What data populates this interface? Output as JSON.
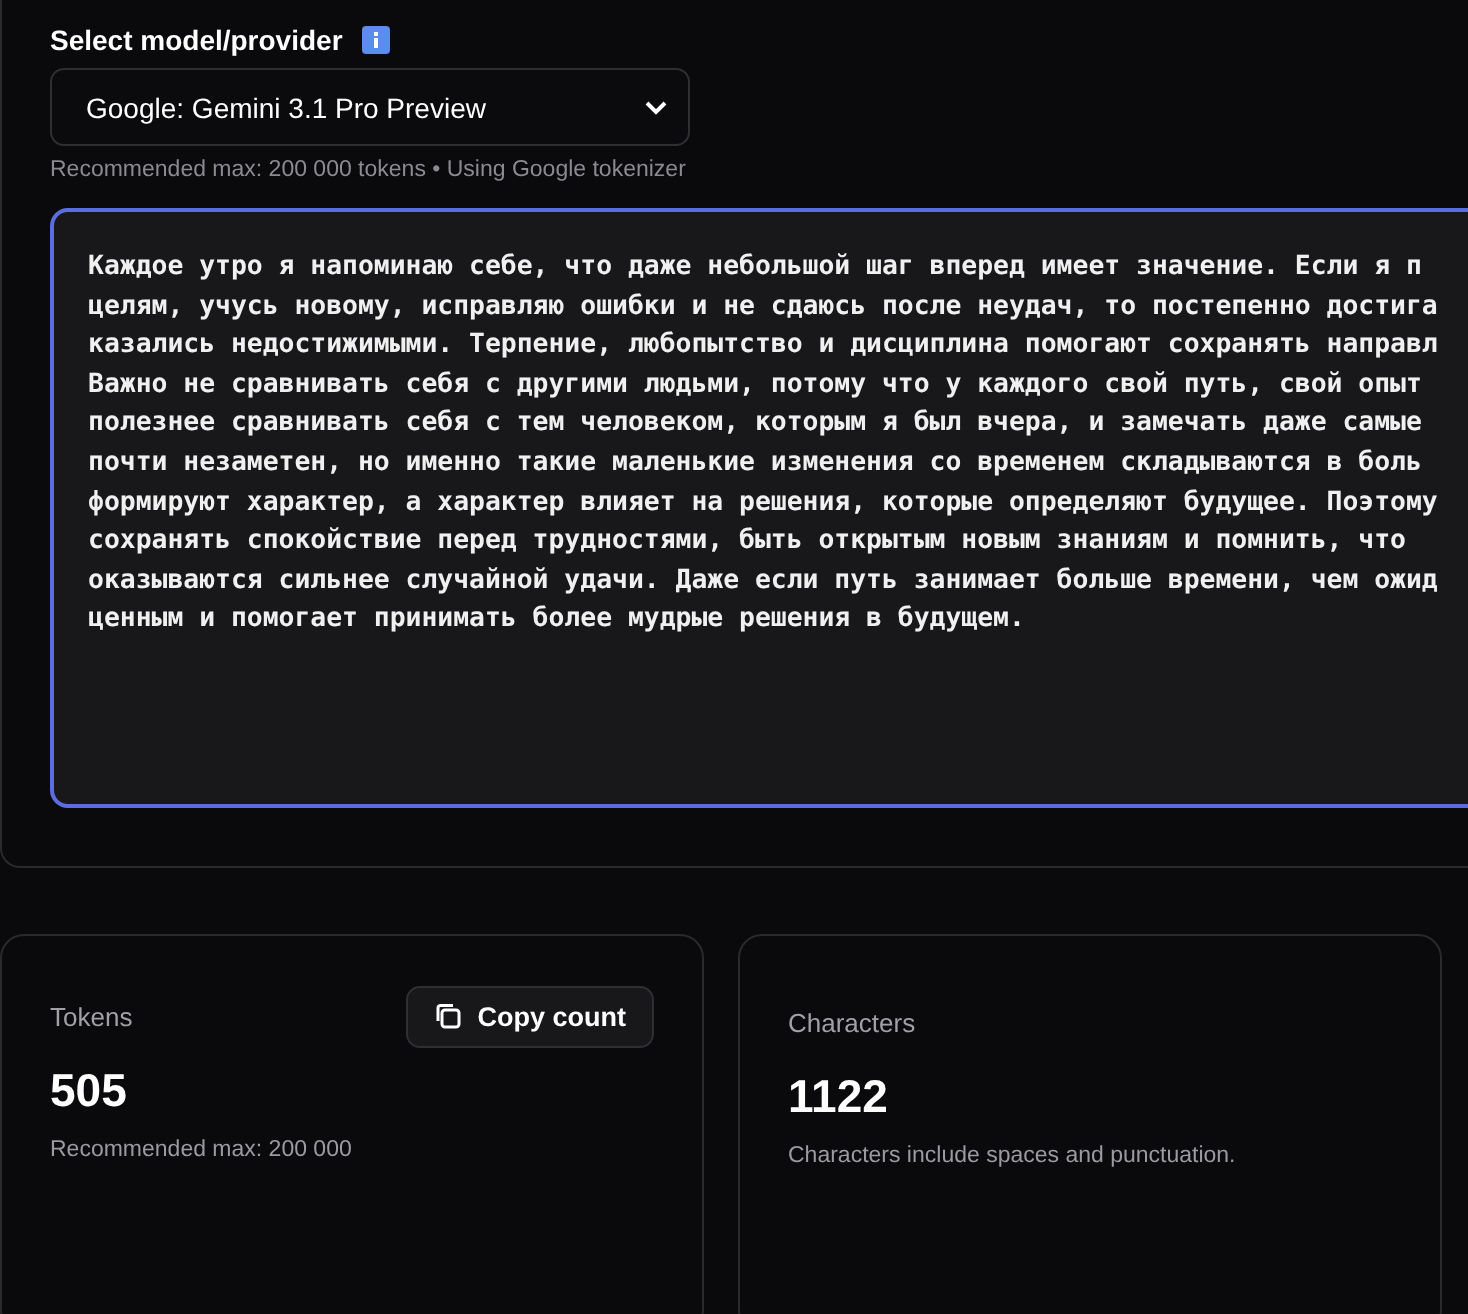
{
  "model_select": {
    "label": "Select model/provider",
    "value": "Google: Gemini 3.1 Pro Preview",
    "hint": "Recommended max: 200 000 tokens • Using Google tokenizer"
  },
  "text_input": {
    "lines": [
      "Каждое утро я напоминаю себе, что даже небольшой шаг вперед имеет значение. Если я п",
      "целям, учусь новому, исправляю ошибки и не сдаюсь после неудач, то постепенно достига",
      "казались недостижимыми. Терпение, любопытство и дисциплина помогают сохранять направл",
      "Важно не сравнивать себя с другими людьми, потому что у каждого свой путь, свой опыт",
      "полезнее сравнивать себя с тем человеком, которым я был вчера, и замечать даже самые",
      "почти незаметен, но именно такие маленькие изменения со временем складываются в боль",
      "формируют характер, а характер влияет на решения, которые определяют будущее. Поэтому",
      "сохранять спокойствие перед трудностями, быть открытым новым знаниям и помнить, что",
      "оказываются сильнее случайной удачи. Даже если путь занимает больше времени, чем ожид",
      "ценным и помогает принимать более мудрые решения в будущем."
    ]
  },
  "stats": [
    {
      "label": "Tokens",
      "value": "505",
      "note": "Recommended max: 200 000",
      "button": "Copy count"
    },
    {
      "label": "Characters",
      "value": "1122",
      "note": "Characters include spaces and punctuation."
    }
  ]
}
